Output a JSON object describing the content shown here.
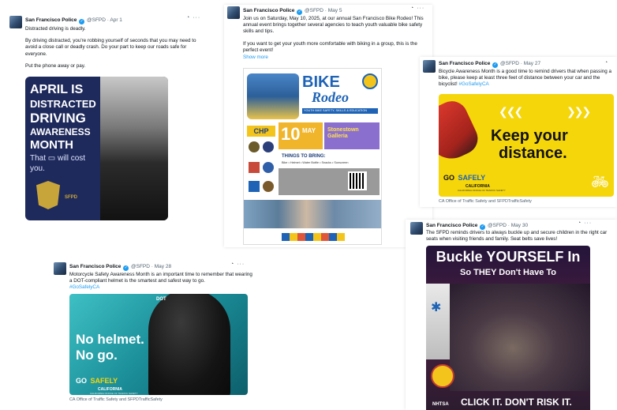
{
  "tweets": {
    "apr1": {
      "account": "San Francisco Police",
      "handle": "@SFPD",
      "date": "Apr 1",
      "text1": "Distracted driving is deadly.",
      "text2": "By driving distracted, you're robbing yourself of seconds that you may need to avoid a close call or deadly crash. Do your part to keep our roads safe for everyone.",
      "text3": "Put the phone away or pay.",
      "image": {
        "line1": "APRIL IS",
        "line2": "DISTRACTED",
        "line3": "DRIVING",
        "line4": "AWARENESS",
        "line5": "MONTH",
        "tag1": "That",
        "tag2": "will cost",
        "tag3": "you.",
        "badge": "SFPD"
      }
    },
    "may5": {
      "account": "San Francisco Police",
      "handle": "@SFPD",
      "date": "May 5",
      "text1": "Join us on Saturday, May 10, 2025, at our annual San Francisco Bike Rodeo! This annual event brings together several agencies to teach youth valuable bike safety skills and tips.",
      "text2": "If you want to get your youth more comfortable with biking in a group, this is the perfect event!",
      "show_more": "Show more",
      "image": {
        "bike": "BIKE",
        "rodeo": "Rodeo",
        "sub": "YOUTH BIKE SAFETY, SKILLS & EDUCATION",
        "day": "10",
        "month": "MAY",
        "venue": "Stonestown Galleria",
        "things_title": "THINGS TO BRING:",
        "things": "Bike • Helmet • Water Bottle • Snacks • Sunscreen",
        "chp": "CHP"
      }
    },
    "may27": {
      "account": "San Francisco Police",
      "handle": "@SFPD",
      "date": "May 27",
      "text": "Bicycle Awareness Month is a good time to remind drivers that when passing a bike, please keep at least three feet of distance between your car and the bicyclist!",
      "hashtag": "#GoSafelyCA",
      "image": {
        "line1": "Keep your",
        "line2": "distance.",
        "brand1": "GO",
        "brand2": "SAFELY",
        "brand3": "CALIFORNIA",
        "brand4": "CALIFORNIA OFFICE OF TRAFFIC SAFETY"
      },
      "caption": "CA Office of Traffic Safety and SFPDTrafficSafety"
    },
    "may28": {
      "account": "San Francisco Police",
      "handle": "@SFPD",
      "date": "May 28",
      "text": "Motorcycle Safety Awareness Month is an important time to remember that wearing a DOT-compliant helmet is the smartest and safest way to go.",
      "hashtag": "#GoSafelyCA",
      "image": {
        "dot": "DOT",
        "line1": "No helmet.",
        "line2": "No go.",
        "brand1": "GO",
        "brand2": "SAFELY",
        "brand3": "CALIFORNIA",
        "brand4": "CALIFORNIA OFFICE OF TRAFFIC SAFETY"
      },
      "caption": "CA Office of Traffic Safety and SFPDTrafficSafety"
    },
    "may30": {
      "account": "San Francisco Police",
      "handle": "@SFPD",
      "date": "May 30",
      "text": "The SFPD reminds drivers to always buckle up and secure children in the right car seats when visiting friends and family. Seat belts save lives!",
      "image": {
        "line1": "Buckle YOURSELF In",
        "line2": "So THEY Don't Have To",
        "footer": "CLICK IT. DON'T RISK IT.",
        "nhtsa": "NHTSA"
      }
    }
  },
  "colors": {
    "link": "#1d9bf0",
    "yellow": "#f5d60a",
    "navy": "#1f2a5c",
    "teal": "#1b8e99"
  }
}
